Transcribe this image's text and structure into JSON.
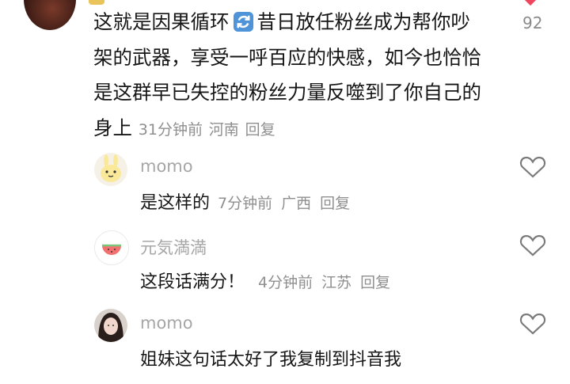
{
  "main_comment": {
    "author": "",
    "text_part1": "这就是因果循环",
    "text_part2": "昔日放任粉丝成为帮你吵架的武器，享受一呼百应的快感，如今也恰恰是这群早已失控的粉丝力量反噬到了你自己的身上",
    "time": "31分钟前",
    "location": "河南",
    "reply_label": "回复",
    "like_count": "92",
    "emoji_icon": "sync-emoji-icon"
  },
  "replies": [
    {
      "name": "momo",
      "text": "是这样的",
      "time": "7分钟前",
      "location": "广西",
      "reply_label": "回复"
    },
    {
      "name": "元気満満",
      "text": "这段话满分！",
      "time": "4分钟前",
      "location": "江苏",
      "reply_label": "回复"
    },
    {
      "name": "momo",
      "text": "姐妹这句话太好了我复制到抖音我",
      "time": "",
      "location": "",
      "reply_label": ""
    }
  ],
  "colors": {
    "heart_red": "#f0455f",
    "meta_gray": "#8f8f8f",
    "name_gray": "#a6a6a6",
    "text": "#161616"
  }
}
